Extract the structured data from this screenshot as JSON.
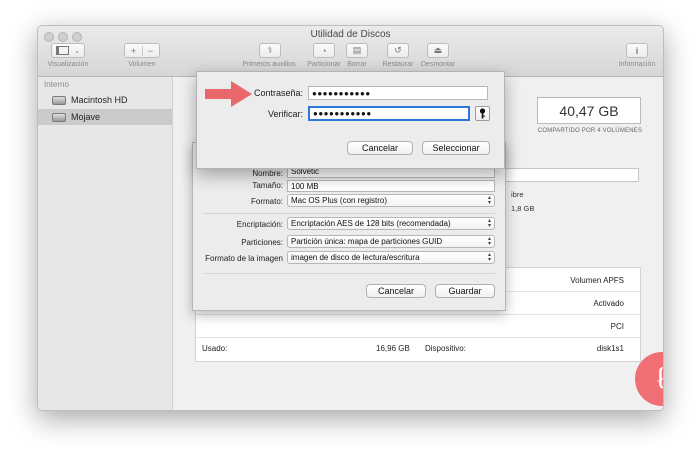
{
  "window": {
    "title": "Utilidad de Discos"
  },
  "toolbar": {
    "visualizacion": "Visualización",
    "volumen": "Volumen",
    "primeros_auxilios": "Primeros auxilios",
    "particionar": "Particionar",
    "borrar": "Borrar",
    "restaurar": "Restaurar",
    "desmontar": "Desmontar",
    "informacion": "Información"
  },
  "sidebar": {
    "header": "Interno",
    "items": [
      {
        "label": "Macintosh HD"
      },
      {
        "label": "Mojave"
      }
    ]
  },
  "capacity": {
    "value": "40,47 GB",
    "subtitle": "COMPARTIDO POR 4 VOLÚMENES"
  },
  "background_fragments": {
    "libre": "ibre",
    "libre_value": "1,8 GB"
  },
  "info_table": {
    "rows": [
      {
        "right_value": "Volumen APFS"
      },
      {
        "right_value": "Activado"
      },
      {
        "right_value": "PCI"
      }
    ],
    "last_row": {
      "left_label": "Usado:",
      "left_value": "16,96 GB",
      "right_label": "Dispositivo:",
      "right_value": "disk1s1"
    }
  },
  "image_sheet": {
    "name_label": "Nombre:",
    "name_value": "Solvetic",
    "size_label": "Tamaño:",
    "size_value": "100 MB",
    "format_label": "Formato:",
    "format_value": "Mac OS Plus (con registro)",
    "encryption_label": "Encriptación:",
    "encryption_value": "Encriptación AES de 128 bits (recomendada)",
    "partitions_label": "Particiones:",
    "partitions_value": "Partición única: mapa de particiones GUID",
    "image_format_label": "Formato de la imagen",
    "image_format_value": "imagen de disco de lectura/escritura",
    "cancel": "Cancelar",
    "save": "Guardar"
  },
  "password_sheet": {
    "password_label": "Contraseña:",
    "password_value": "●●●●●●●●●●●",
    "verify_label": "Verificar:",
    "verify_value": "●●●●●●●●●●●",
    "cancel": "Cancelar",
    "select": "Seleccionar"
  },
  "colors": {
    "accent": "#2f76d9",
    "arrow": "#e8686b",
    "watermark": "#ef6f75"
  }
}
